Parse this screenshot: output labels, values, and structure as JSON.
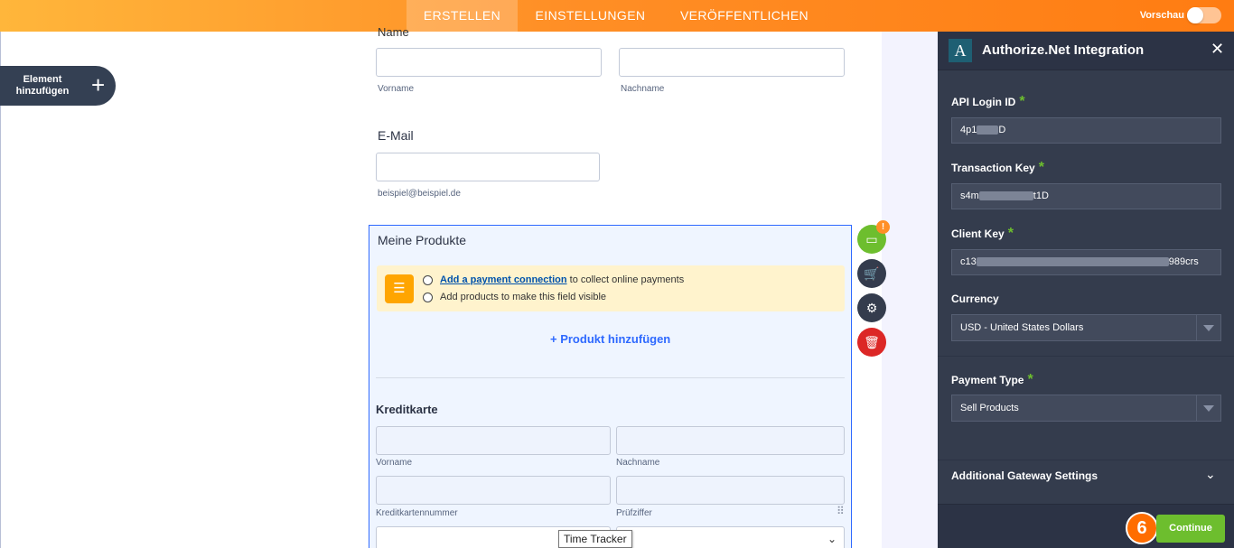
{
  "topbar": {
    "tabs": [
      {
        "label": "ERSTELLEN",
        "active": true
      },
      {
        "label": "EINSTELLUNGEN",
        "active": false
      },
      {
        "label": "VERÖFFENTLICHEN",
        "active": false
      }
    ],
    "preview_label": "Vorschau",
    "preview_on": false
  },
  "left": {
    "add_element_label": "Element hinzufügen",
    "add_element_icon": "plus-icon"
  },
  "form": {
    "name_label": "Name",
    "first_name_sub": "Vorname",
    "last_name_sub": "Nachname",
    "email_label": "E-Mail",
    "email_sub": "beispiel@beispiel.de",
    "products_title": "Meine Produkte",
    "notice_link": "Add a payment connection",
    "notice_line1_rest": " to collect online payments",
    "notice_line2": "Add products to make this field visible",
    "add_product": "+ Produkt hinzufügen",
    "cc_title": "Kreditkarte",
    "cc_first_name": "Vorname",
    "cc_last_name": "Nachname",
    "cc_number": "Kreditkartennummer",
    "cc_cvv": "Prüfziffer",
    "tooltip": "Time Tracker"
  },
  "actions": {
    "badge": "!",
    "icons": [
      "credit-card-icon",
      "cart-icon",
      "gear-icon",
      "trash-icon"
    ]
  },
  "panel": {
    "logo_letter": "A",
    "title": "Authorize.Net Integration",
    "api_login_label": "API Login ID",
    "api_login_prefix": "4p1",
    "api_login_suffix": "D",
    "transaction_key_label": "Transaction Key",
    "transaction_key_prefix": "s4m",
    "transaction_key_suffix": "t1D",
    "client_key_label": "Client Key",
    "client_key_prefix": "c13",
    "client_key_suffix": "989crs",
    "currency_label": "Currency",
    "currency_value": "USD - United States Dollars",
    "payment_type_label": "Payment Type",
    "payment_type_value": "Sell Products",
    "additional_settings": "Additional Gateway Settings",
    "step_number": "6",
    "continue_label": "Continue",
    "colors": {
      "accent_green": "#6dbe2e",
      "panel_bg": "#343c4d",
      "orange": "#ff8f26"
    }
  }
}
